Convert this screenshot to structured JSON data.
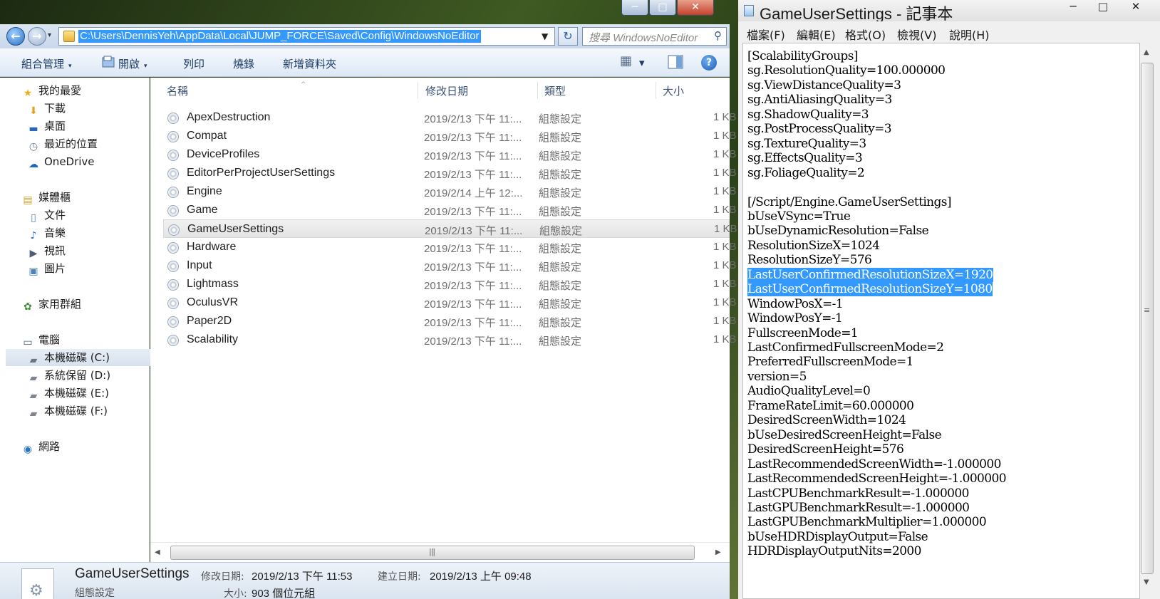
{
  "explorer": {
    "window_buttons": {
      "minimize": "─",
      "maximize": "□",
      "close": "✕"
    },
    "nav": {
      "back": "←",
      "forward": "→",
      "dropdown": "▾"
    },
    "address_path": "C:\\Users\\DennisYeh\\AppData\\Local\\JUMP_FORCE\\Saved\\Config\\WindowsNoEditor",
    "address_dropdown": "▼",
    "refresh": "↻",
    "search_placeholder": "搜尋 WindowsNoEditor",
    "search_icon": "⚲",
    "toolbar": {
      "organize": "組合管理",
      "open": "開啟",
      "print": "列印",
      "burn": "燒錄",
      "new_folder": "新增資料夾",
      "caret": "▾",
      "view_icon": "▦",
      "help": "?"
    },
    "nav_pane": [
      {
        "label": "我的最愛",
        "icon": "★",
        "color": "#e8b21e"
      },
      {
        "label": "下載",
        "icon": "⬇",
        "color": "#e0a21f"
      },
      {
        "label": "桌面",
        "icon": "▬",
        "color": "#2a66b8"
      },
      {
        "label": "最近的位置",
        "icon": "◷",
        "color": "#6a7d96"
      },
      {
        "label": "OneDrive",
        "icon": "☁",
        "color": "#1f65c2"
      },
      {
        "label": "媒體櫃",
        "icon": "▤",
        "color": "#d9a027"
      },
      {
        "label": "文件",
        "icon": "▯",
        "color": "#5a7ea8"
      },
      {
        "label": "音樂",
        "icon": "♪",
        "color": "#2c6fbf"
      },
      {
        "label": "視訊",
        "icon": "▶",
        "color": "#4a5f7a"
      },
      {
        "label": "圖片",
        "icon": "▣",
        "color": "#4d82b8"
      },
      {
        "label": "家用群組",
        "icon": "✿",
        "color": "#3f8f3a"
      },
      {
        "label": "電腦",
        "icon": "▭",
        "color": "#48607e"
      },
      {
        "label": "本機磁碟 (C:)",
        "icon": "▰",
        "color": "#6b7685"
      },
      {
        "label": "系統保留 (D:)",
        "icon": "▰",
        "color": "#7d8692"
      },
      {
        "label": "本機磁碟 (E:)",
        "icon": "▰",
        "color": "#7d8692"
      },
      {
        "label": "本機磁碟 (F:)",
        "icon": "▰",
        "color": "#7d8692"
      },
      {
        "label": "網路",
        "icon": "◉",
        "color": "#2b73c4"
      }
    ],
    "columns": {
      "name": "名稱",
      "date": "修改日期",
      "type": "類型",
      "size": "大小",
      "sort_arrow": "^"
    },
    "files": [
      {
        "name": "ApexDestruction",
        "date": "2019/2/13 下午 11:...",
        "type": "組態設定",
        "size": "1 KB"
      },
      {
        "name": "Compat",
        "date": "2019/2/13 下午 11:...",
        "type": "組態設定",
        "size": "1 KB"
      },
      {
        "name": "DeviceProfiles",
        "date": "2019/2/13 下午 11:...",
        "type": "組態設定",
        "size": "1 KB"
      },
      {
        "name": "EditorPerProjectUserSettings",
        "date": "2019/2/13 下午 11:...",
        "type": "組態設定",
        "size": "1 KB"
      },
      {
        "name": "Engine",
        "date": "2019/2/14 上午 12:...",
        "type": "組態設定",
        "size": "1 KB"
      },
      {
        "name": "Game",
        "date": "2019/2/13 下午 11:...",
        "type": "組態設定",
        "size": "1 KB"
      },
      {
        "name": "GameUserSettings",
        "date": "2019/2/13 下午 11:...",
        "type": "組態設定",
        "size": "1 KB"
      },
      {
        "name": "Hardware",
        "date": "2019/2/13 下午 11:...",
        "type": "組態設定",
        "size": "1 KB"
      },
      {
        "name": "Input",
        "date": "2019/2/13 下午 11:...",
        "type": "組態設定",
        "size": "1 KB"
      },
      {
        "name": "Lightmass",
        "date": "2019/2/13 下午 11:...",
        "type": "組態設定",
        "size": "1 KB"
      },
      {
        "name": "OculusVR",
        "date": "2019/2/13 下午 11:...",
        "type": "組態設定",
        "size": "1 KB"
      },
      {
        "name": "Paper2D",
        "date": "2019/2/13 下午 11:...",
        "type": "組態設定",
        "size": "1 KB"
      },
      {
        "name": "Scalability",
        "date": "2019/2/13 下午 11:...",
        "type": "組態設定",
        "size": "1 KB"
      }
    ],
    "selected_file": "GameUserSettings",
    "hscroll": {
      "left": "◀",
      "right": "▶",
      "grip": "|||"
    },
    "details": {
      "name": "GameUserSettings",
      "kind": "組態設定",
      "modified_label": "修改日期:",
      "modified_value": "2019/2/13 下午 11:53",
      "created_label": "建立日期:",
      "created_value": "2019/2/13 上午 09:48",
      "size_label": "大小:",
      "size_value": "903 個位元組",
      "icon": "⚙"
    }
  },
  "notepad": {
    "title": "GameUserSettings - 記事本",
    "window_buttons": {
      "minimize": "─",
      "maximize": "□",
      "close": "✕"
    },
    "menu": [
      "檔案(F)",
      "編輯(E)",
      "格式(O)",
      "檢視(V)",
      "說明(H)"
    ],
    "lines": [
      {
        "text": "[ScalabilityGroups]"
      },
      {
        "text": "sg.ResolutionQuality=100.000000"
      },
      {
        "text": "sg.ViewDistanceQuality=3"
      },
      {
        "text": "sg.AntiAliasingQuality=3"
      },
      {
        "text": "sg.ShadowQuality=3"
      },
      {
        "text": "sg.PostProcessQuality=3"
      },
      {
        "text": "sg.TextureQuality=3"
      },
      {
        "text": "sg.EffectsQuality=3"
      },
      {
        "text": "sg.FoliageQuality=2"
      },
      {
        "text": ""
      },
      {
        "text": "[/Script/Engine.GameUserSettings]"
      },
      {
        "text": "bUseVSync=True"
      },
      {
        "text": "bUseDynamicResolution=False"
      },
      {
        "text": "ResolutionSizeX=1024"
      },
      {
        "text": "ResolutionSizeY=576"
      },
      {
        "text": "LastUserConfirmedResolutionSizeX=1920",
        "selected": true
      },
      {
        "text": "LastUserConfirmedResolutionSizeY=1080",
        "selected": true
      },
      {
        "text": "WindowPosX=-1"
      },
      {
        "text": "WindowPosY=-1"
      },
      {
        "text": "FullscreenMode=1"
      },
      {
        "text": "LastConfirmedFullscreenMode=2"
      },
      {
        "text": "PreferredFullscreenMode=1"
      },
      {
        "text": "version=5"
      },
      {
        "text": "AudioQualityLevel=0"
      },
      {
        "text": "FrameRateLimit=60.000000"
      },
      {
        "text": "DesiredScreenWidth=1024"
      },
      {
        "text": "bUseDesiredScreenHeight=False"
      },
      {
        "text": "DesiredScreenHeight=576"
      },
      {
        "text": "LastRecommendedScreenWidth=-1.000000"
      },
      {
        "text": "LastRecommendedScreenHeight=-1.000000"
      },
      {
        "text": "LastCPUBenchmarkResult=-1.000000"
      },
      {
        "text": "LastGPUBenchmarkResult=-1.000000"
      },
      {
        "text": "LastGPUBenchmarkMultiplier=1.000000"
      },
      {
        "text": "bUseHDRDisplayOutput=False"
      },
      {
        "text": "HDRDisplayOutputNits=2000"
      }
    ],
    "vscroll": {
      "up": "▲",
      "down": "▼",
      "grip": "≡"
    }
  }
}
